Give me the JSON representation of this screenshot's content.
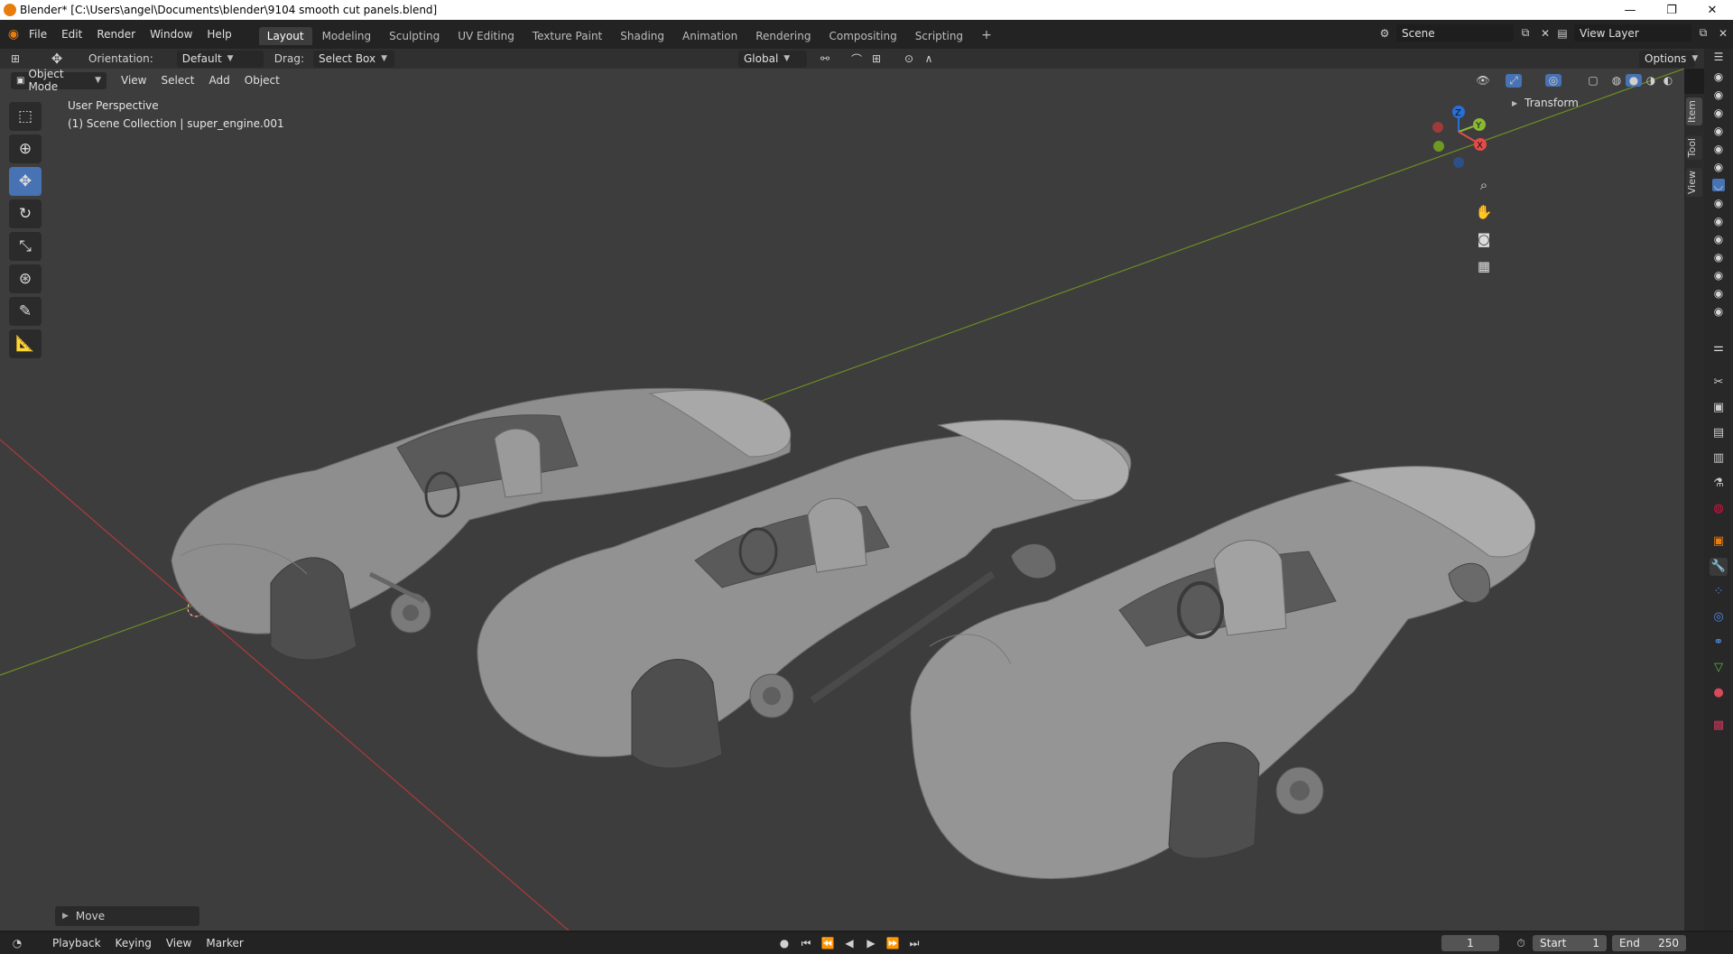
{
  "window": {
    "title": "Blender* [C:\\Users\\angel\\Documents\\blender\\9104 smooth cut panels.blend]",
    "minimize": "—",
    "maximize": "❐",
    "close": "✕"
  },
  "menu": [
    "File",
    "Edit",
    "Render",
    "Window",
    "Help"
  ],
  "workspaces": [
    "Layout",
    "Modeling",
    "Sculpting",
    "UV Editing",
    "Texture Paint",
    "Shading",
    "Animation",
    "Rendering",
    "Compositing",
    "Scripting"
  ],
  "workspace_add": "+",
  "scene": {
    "name": "Scene",
    "view_layer": "View Layer"
  },
  "tool_header": {
    "orientation_label": "Orientation:",
    "orientation_value": "Default",
    "drag_label": "Drag:",
    "drag_value": "Select Box",
    "transform_orientation": "Global",
    "options": "Options"
  },
  "viewport_header": {
    "mode": "Object Mode",
    "menus": [
      "View",
      "Select",
      "Add",
      "Object"
    ]
  },
  "viewport": {
    "perspective": "User Perspective",
    "collection": "(1) Scene Collection | super_engine.001"
  },
  "gizmo": {
    "z": "Z",
    "y": "Y",
    "x": "X"
  },
  "sidebar": {
    "panel": "Transform",
    "tabs": [
      "Item",
      "Tool",
      "View"
    ]
  },
  "last_operator": "Move",
  "timeline": {
    "menus": [
      "Playback",
      "Keying",
      "View",
      "Marker"
    ],
    "current_frame": "1",
    "start_label": "Start",
    "start_value": "1",
    "end_label": "End",
    "end_value": "250"
  },
  "colors": {
    "accent": "#4772b3",
    "x_axis": "#b03a3a",
    "y_axis": "#6b8e23",
    "viewport_bg": "#3d3d3d"
  },
  "icons": {
    "toolbar": [
      "select-box-icon",
      "cursor-icon",
      "move-icon",
      "rotate-icon",
      "scale-icon",
      "transform-icon",
      "annotate-icon",
      "measure-icon"
    ],
    "navigation": [
      "zoom-icon",
      "pan-hand-icon",
      "camera-icon",
      "grid-ortho-icon"
    ]
  }
}
